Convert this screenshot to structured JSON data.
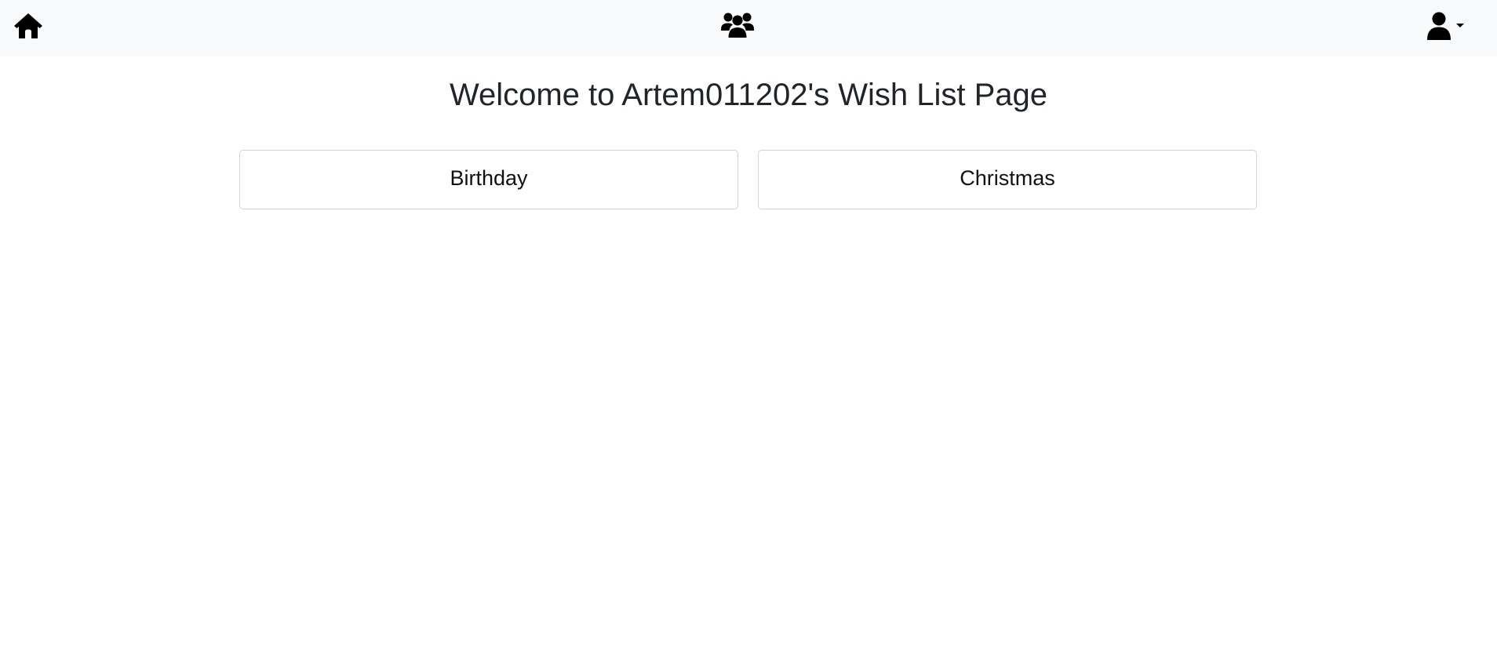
{
  "navbar": {
    "home_icon": "home-icon",
    "friends_icon": "users-group-icon",
    "user_icon": "user-icon",
    "user_menu_caret": "caret-down-icon"
  },
  "main": {
    "title": "Welcome to Artem011202's Wish List Page",
    "wish_lists": [
      {
        "label": "Birthday"
      },
      {
        "label": "Christmas"
      }
    ]
  },
  "colors": {
    "navbar_bg": "#f8f9fa",
    "text": "#212529",
    "card_border": "#cfd2d6"
  }
}
